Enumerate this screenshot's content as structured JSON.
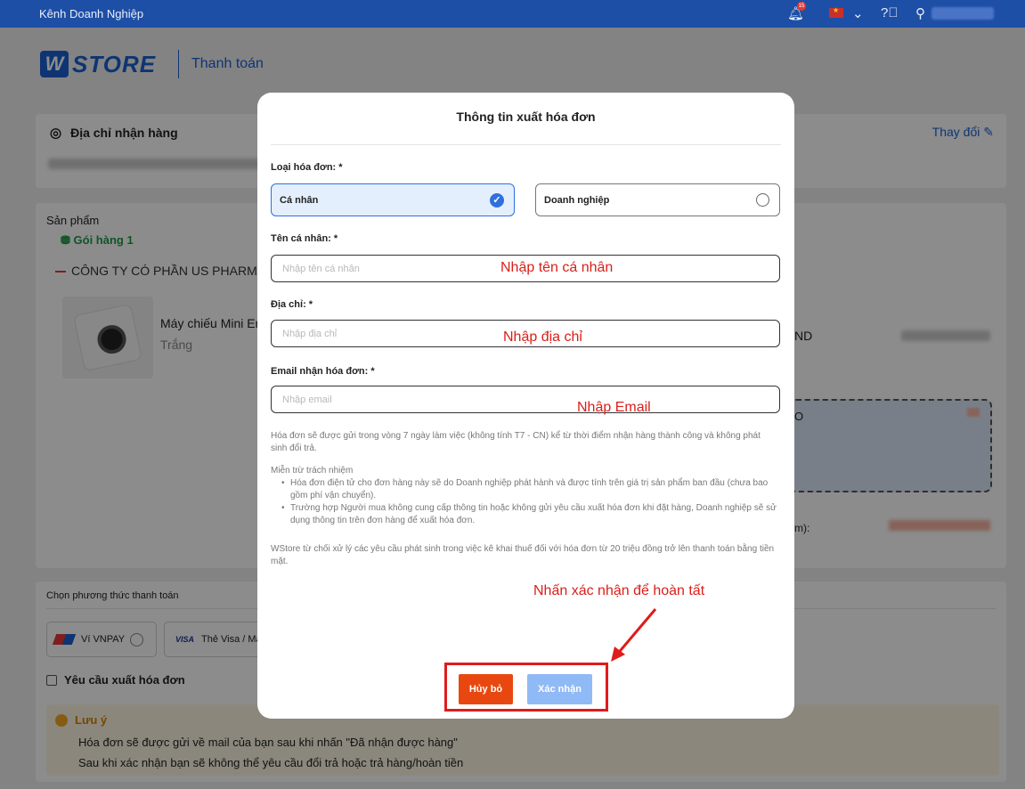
{
  "topbar": {
    "brand": "Kênh Doanh Nghiệp",
    "notification_count": "15"
  },
  "page": {
    "logo_text": "STORE",
    "section": "Thanh toán",
    "address": {
      "title": "Địa chỉ nhận hàng",
      "change": "Thay đổi"
    },
    "products": {
      "title": "Sản phẩm",
      "package": "Gói hàng 1",
      "company": "CÔNG TY CÓ PHẦN US PHARMA",
      "product_name": "Máy chiếu Mini Er",
      "variant": "Trắng",
      "currency_fragment": "ND",
      "voucher_fragment": "O",
      "total_fragment": "m):"
    },
    "payment": {
      "title": "Chọn phương thức thanh toán",
      "vnpay": "Ví VNPAY",
      "visa_logo": "VISA",
      "visa": "Thẻ Visa / Ma",
      "invoice_request": "Yêu cầu xuất hóa đơn",
      "note_title": "Lưu ý",
      "note_line1": "Hóa đơn sẽ được gửi về mail của bạn sau khi nhấn \"Đã nhận được hàng\"",
      "note_line2": "Sau khi xác nhận bạn sẽ không thể yêu cầu đổi trả hoặc trả hàng/hoàn tiền"
    }
  },
  "modal": {
    "title": "Thông tin xuất hóa đơn",
    "type_label": "Loại hóa đơn: *",
    "option_personal": "Cá nhân",
    "option_business": "Doanh nghiệp",
    "name_label": "Tên cá nhân: *",
    "name_placeholder": "Nhập tên cá nhân",
    "address_label": "Địa chỉ: *",
    "address_placeholder": "Nhập địa chỉ",
    "email_label": "Email nhận hóa đơn: *",
    "email_placeholder": "Nhập email",
    "info_note": "Hóa đơn sẽ được gửi trong vòng 7 ngày làm việc (không tính T7 - CN) kể từ thời điểm nhận hàng thành công và không phát sinh đổi trả.",
    "disclaimer_title": "Miễn trừ trách nhiệm",
    "disclaimer_items": [
      "Hóa đơn điện tử cho đơn hàng này sẽ do Doanh nghiệp phát hành và được tính trên giá trị sản phẩm ban đầu (chưa bao gồm phí vận chuyển).",
      "Trường hợp Người mua không cung cấp thông tin hoặc không gửi yêu cầu xuất hóa đơn khi đặt hàng, Doanh nghiệp sẽ sử dụng thông tin trên đơn hàng để xuất hóa đơn."
    ],
    "tax_note": "WStore từ chối xử lý các yêu cầu phát sinh trong việc kê khai thuế đối với hóa đơn từ 20 triệu đồng trở lên thanh toán bằng tiền mặt.",
    "cancel": "Hủy bỏ",
    "confirm": "Xác nhận"
  },
  "annotations": {
    "name": "Nhập tên cá nhân",
    "address": "Nhập địa chỉ",
    "email": "Nhập Email",
    "confirm_hint": "Nhấn xác nhận để hoàn tất"
  },
  "colors": {
    "topbar": "#1e4fa6",
    "primary": "#2f6fe0",
    "cancel": "#e8480f",
    "confirm": "#8fbaf6",
    "annotation": "#d9201a"
  }
}
